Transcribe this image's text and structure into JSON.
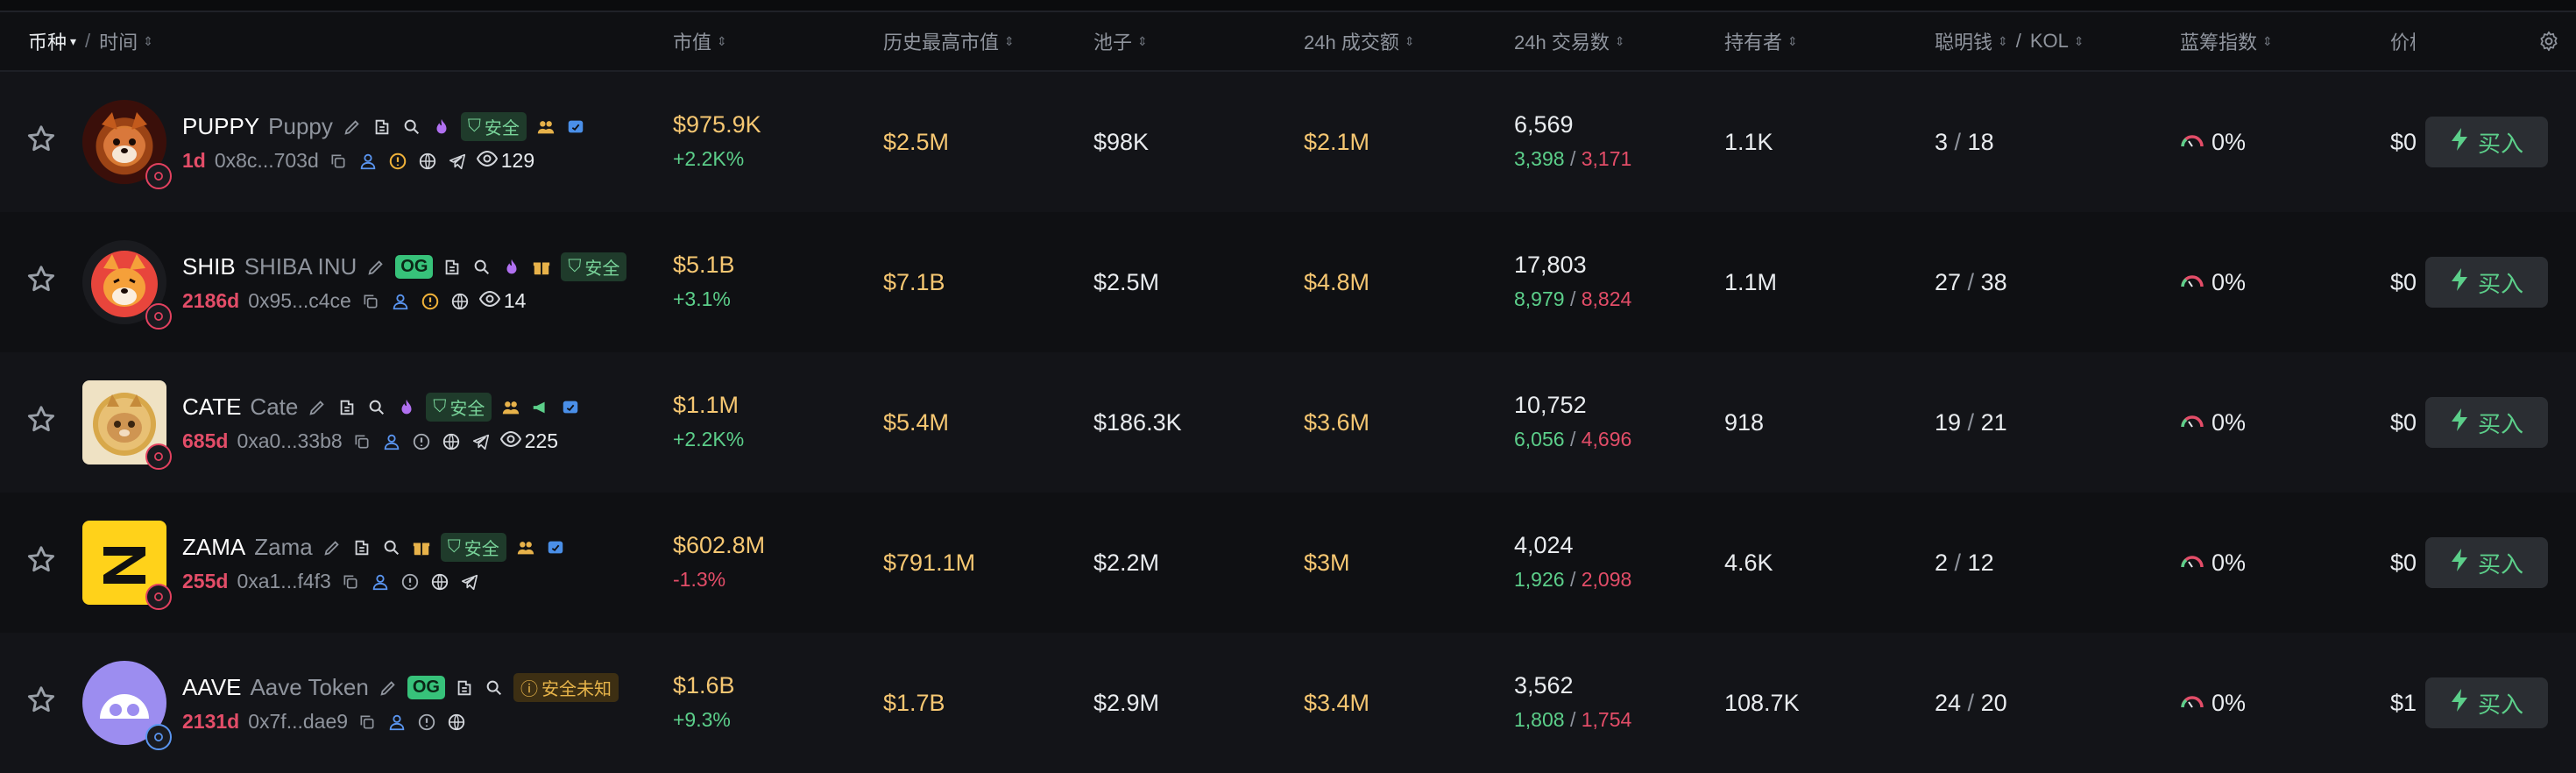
{
  "header": {
    "coin": "币种",
    "time": "时间",
    "market_cap": "市值",
    "ath_cap": "历史最高市值",
    "pool": "池子",
    "vol24": "24h 成交额",
    "tx24": "24h 交易数",
    "holders": "持有者",
    "smart": "聪明钱",
    "kol": "KOL",
    "bluechip": "蓝筹指数",
    "price": "价格"
  },
  "labels": {
    "safe": "安全",
    "unknown": "安全未知",
    "og": "OG",
    "buy": "买入"
  },
  "rows": [
    {
      "symbol": "PUPPY",
      "name": "Puppy",
      "age": "1d",
      "address": "0x8c...703d",
      "views": "129",
      "mcap": "$975.9K",
      "change": "+2.2K%",
      "ath": "$2.5M",
      "pool": "$98K",
      "vol": "$2.1M",
      "tx": "6,569",
      "buys": "3,398",
      "sells": "3,171",
      "holders": "1.1K",
      "smart": "3",
      "kol": "18",
      "bluechip": "0%",
      "price": "$0"
    },
    {
      "symbol": "SHIB",
      "name": "SHIBA INU",
      "age": "2186d",
      "address": "0x95...c4ce",
      "views": "14",
      "mcap": "$5.1B",
      "change": "+3.1%",
      "ath": "$7.1B",
      "pool": "$2.5M",
      "vol": "$4.8M",
      "tx": "17,803",
      "buys": "8,979",
      "sells": "8,824",
      "holders": "1.1M",
      "smart": "27",
      "kol": "38",
      "bluechip": "0%",
      "price": "$0"
    },
    {
      "symbol": "CATE",
      "name": "Cate",
      "age": "685d",
      "address": "0xa0...33b8",
      "views": "225",
      "mcap": "$1.1M",
      "change": "+2.2K%",
      "ath": "$5.4M",
      "pool": "$186.3K",
      "vol": "$3.6M",
      "tx": "10,752",
      "buys": "6,056",
      "sells": "4,696",
      "holders": "918",
      "smart": "19",
      "kol": "21",
      "bluechip": "0%",
      "price": "$0"
    },
    {
      "symbol": "ZAMA",
      "name": "Zama",
      "age": "255d",
      "address": "0xa1...f4f3",
      "views": "",
      "mcap": "$602.8M",
      "change": "-1.3%",
      "ath": "$791.1M",
      "pool": "$2.2M",
      "vol": "$3M",
      "tx": "4,024",
      "buys": "1,926",
      "sells": "2,098",
      "holders": "4.6K",
      "smart": "2",
      "kol": "12",
      "bluechip": "0%",
      "price": "$0"
    },
    {
      "symbol": "AAVE",
      "name": "Aave Token",
      "age": "2131d",
      "address": "0x7f...dae9",
      "views": "",
      "mcap": "$1.6B",
      "change": "+9.3%",
      "ath": "$1.7B",
      "pool": "$2.9M",
      "vol": "$3.4M",
      "tx": "3,562",
      "buys": "1,808",
      "sells": "1,754",
      "holders": "108.7K",
      "smart": "24",
      "kol": "20",
      "bluechip": "0%",
      "price": "$1"
    }
  ],
  "colors": {
    "green": "#5ccf8a",
    "red": "#e34d68",
    "yellow": "#f6c772"
  },
  "icons": [
    "star-icon",
    "edit-icon",
    "share-icon",
    "search-icon",
    "fire-icon",
    "shield-icon",
    "people-icon",
    "gift-icon",
    "twitter-icon",
    "copy-icon",
    "user-icon",
    "warning-icon",
    "globe-icon",
    "telegram-icon",
    "eye-icon",
    "gauge-icon",
    "lightning-icon",
    "gear-icon",
    "chain-badge-icon"
  ]
}
